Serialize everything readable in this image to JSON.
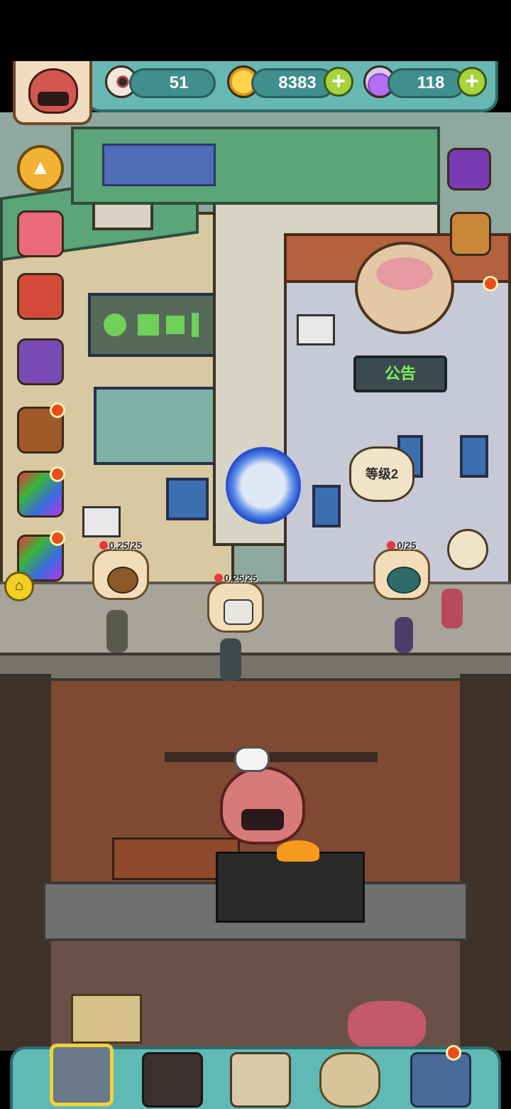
{
  "resources": {
    "eyeballs": "51",
    "coins": "8383",
    "potions": "118"
  },
  "buildings": {
    "notice_sign": "公告",
    "level_bubble": "等级2"
  },
  "production": [
    {
      "label": "0.25/25"
    },
    {
      "label": "0.25/25"
    },
    {
      "label": "0/25"
    }
  ],
  "icons": {
    "resource_1": "eyeball-icon",
    "resource_2": "coin-icon",
    "resource_3": "potion-icon",
    "add": "plus-icon",
    "scroll": "chevron-up-icon",
    "home": "home-icon"
  },
  "colors": {
    "panel_teal": "#67b7b2",
    "plus_green": "#a6d23a",
    "badge_red": "#f04a1a"
  }
}
